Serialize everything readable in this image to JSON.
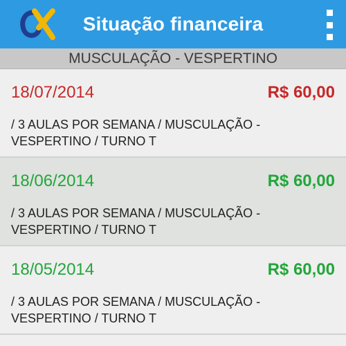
{
  "appbar": {
    "title": "Situação financeira",
    "logo_icon": "ix-logo-icon",
    "menu_icon": "overflow-menu-icon",
    "background": "#2d9ae2"
  },
  "section": {
    "label": "MUSCULAÇÃO - VESPERTINO"
  },
  "colors": {
    "pending": "#c62828",
    "paid": "#22a63a"
  },
  "payments": [
    {
      "date": "18/07/2014",
      "amount": "R$ 60,00",
      "description": " / 3 AULAS POR SEMANA / MUSCULAÇÃO - VESPERTINO / TURNO T",
      "status_color": "red"
    },
    {
      "date": "18/06/2014",
      "amount": "R$ 60,00",
      "description": " / 3 AULAS POR SEMANA / MUSCULAÇÃO - VESPERTINO / TURNO T",
      "status_color": "green"
    },
    {
      "date": "18/05/2014",
      "amount": "R$ 60,00",
      "description": " / 3 AULAS POR SEMANA / MUSCULAÇÃO - VESPERTINO / TURNO T",
      "status_color": "green"
    }
  ]
}
